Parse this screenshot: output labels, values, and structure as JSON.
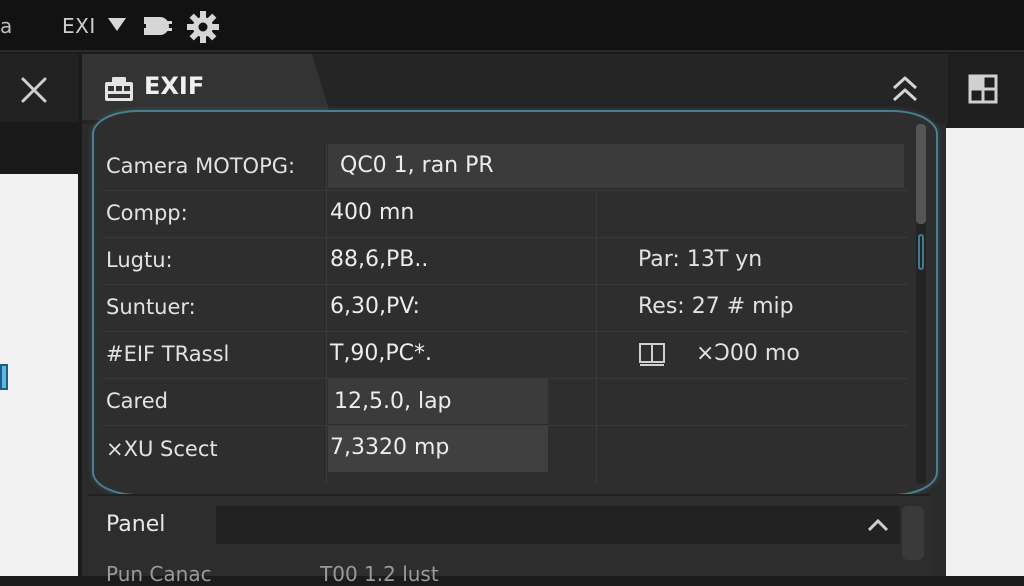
{
  "toolbar": {
    "left_fragment": "a",
    "menu_label": "EXI",
    "icons": [
      "dropdown-caret-icon",
      "plug-icon",
      "gear-icon"
    ]
  },
  "panel": {
    "title": "EXIF",
    "rows": [
      {
        "label": "Camera MOTOPG:",
        "value": "QC0 1, ran PR",
        "right": ""
      },
      {
        "label": "Compp:",
        "value": "400 mn",
        "right": ""
      },
      {
        "label": "Lugtu:",
        "value": "88,6,PB..",
        "right": "Par: 13T yn"
      },
      {
        "label": "Suntuer:",
        "value": "6,30,PV:",
        "right": "Res: 27 # mip"
      },
      {
        "label": "#EIF TRassl",
        "value": "T,90,PC*.",
        "right": "×Ↄ00 mo"
      },
      {
        "label": "Cared",
        "value": "12,5.0, lap",
        "right": ""
      },
      {
        "label": "×XU Scect",
        "value": "7,3320 mp",
        "right": ""
      }
    ]
  },
  "sub_panel": {
    "label": "Panel",
    "cut_left": "Pun Canac",
    "cut_right": "T00 1.2 lust"
  },
  "colors": {
    "frame_accent": "#4a7f91",
    "selection_blue": "#5fb6e4"
  }
}
